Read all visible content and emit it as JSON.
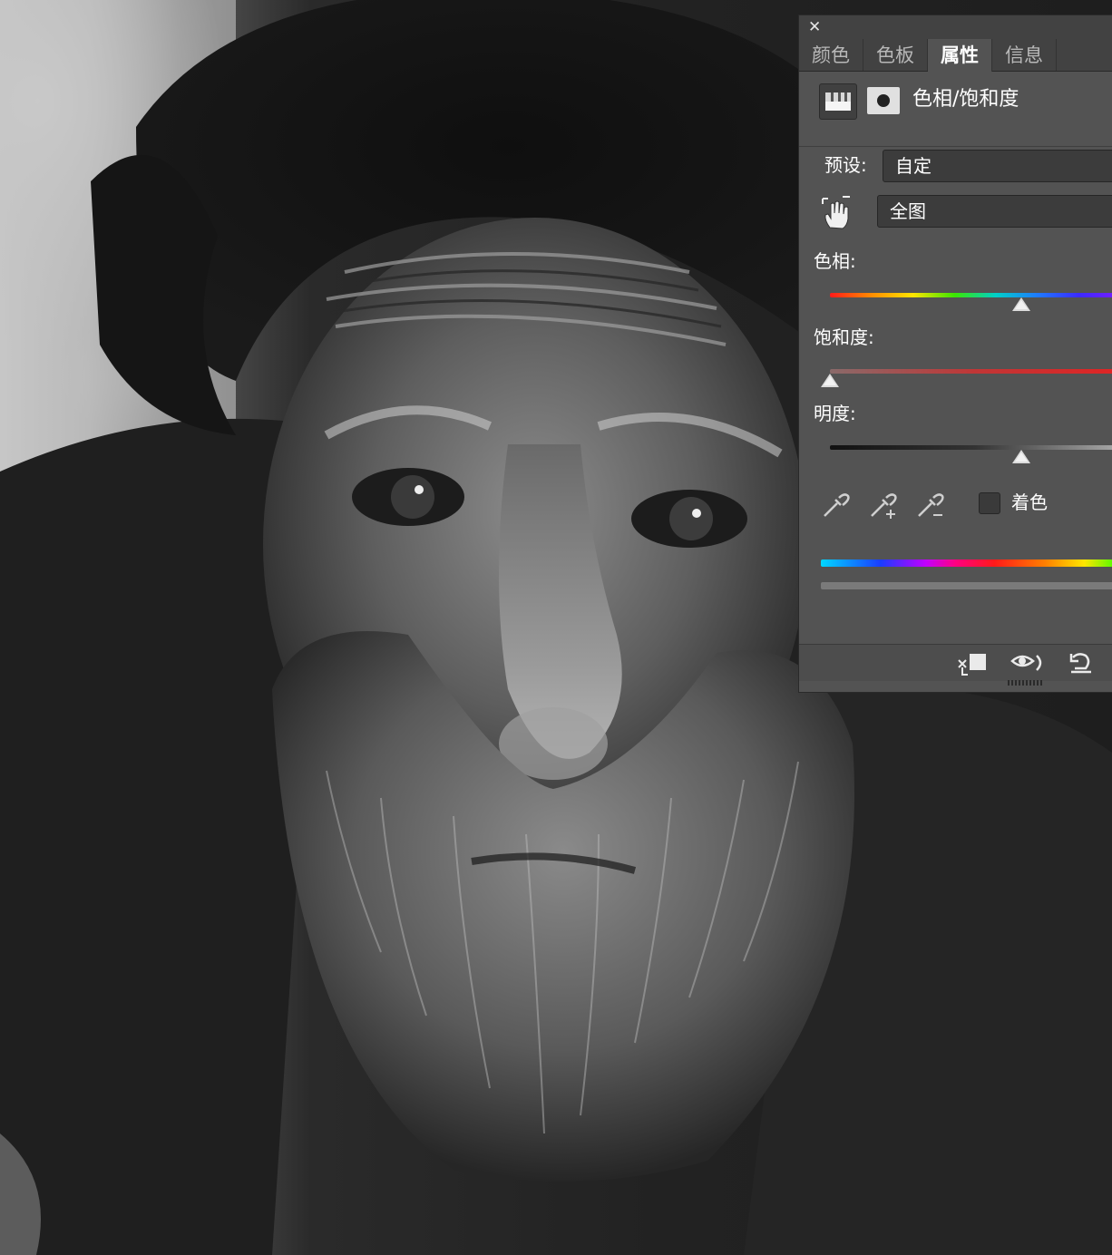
{
  "panel": {
    "tabs": [
      {
        "label": "颜色",
        "active": false
      },
      {
        "label": "色板",
        "active": false
      },
      {
        "label": "属性",
        "active": true
      },
      {
        "label": "信息",
        "active": false
      }
    ],
    "header_title": "色相/饱和度",
    "preset_label": "预设:",
    "preset_value": "自定",
    "channel_value": "全图",
    "hue_label": "色相:",
    "saturation_label": "饱和度:",
    "lightness_label": "明度:",
    "colorize_label": "着色",
    "colorize_checked": false,
    "hue_level": 0.66,
    "saturation_level": 0.0,
    "lightness_level": 0.66
  },
  "icons": {
    "close": "close-icon",
    "adjustment": "hue-saturation-adjustment-icon",
    "mask": "layer-mask-icon",
    "targeted_adjust": "targeted-adjustment-hand-icon",
    "eyedropper": "eyedropper-icon",
    "eyedropper_add": "eyedropper-add-icon",
    "eyedropper_subtract": "eyedropper-subtract-icon",
    "clip": "clip-to-layer-icon",
    "visibility": "view-previous-state-icon",
    "reset": "reset-icon"
  },
  "colors": {
    "panel_bg": "#535353",
    "saturation_track": "#e02424",
    "accent_text": "#ffffff"
  }
}
